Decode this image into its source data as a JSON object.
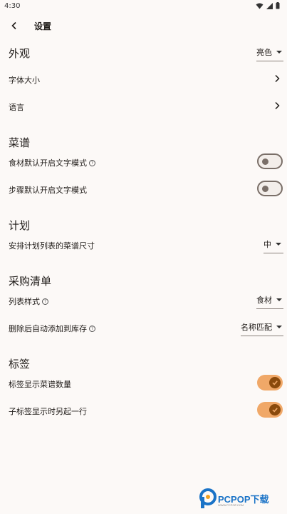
{
  "status_bar": {
    "time": "4:30"
  },
  "header": {
    "title": "设置"
  },
  "sections": {
    "appearance": {
      "title": "外观",
      "theme_value": "亮色",
      "font_size_label": "字体大小",
      "language_label": "语言"
    },
    "recipes": {
      "title": "菜谱",
      "ingredients_text_mode_label": "食材默认开启文字模式",
      "steps_text_mode_label": "步骤默认开启文字模式"
    },
    "plan": {
      "title": "计划",
      "recipe_size_label": "安排计划列表的菜谱尺寸",
      "recipe_size_value": "中"
    },
    "shopping": {
      "title": "采购清单",
      "list_style_label": "列表样式",
      "list_style_value": "食材",
      "auto_add_label": "删除后自动添加到库存",
      "auto_add_value": "名称匹配"
    },
    "tags": {
      "title": "标签",
      "show_count_label": "标签显示菜谱数量",
      "sub_tag_newline_label": "子标签显示时另起一行"
    }
  },
  "toggles": {
    "ingredients_text_mode": false,
    "steps_text_mode": false,
    "show_count": true,
    "sub_tag_newline": true
  },
  "colors": {
    "accent": "#f0a868",
    "accent_dark": "#8a4a0c",
    "background": "#fcf9f7"
  },
  "watermark": {
    "text": "PCPOP下载",
    "sub": "WWW.PCPOP.COM"
  }
}
